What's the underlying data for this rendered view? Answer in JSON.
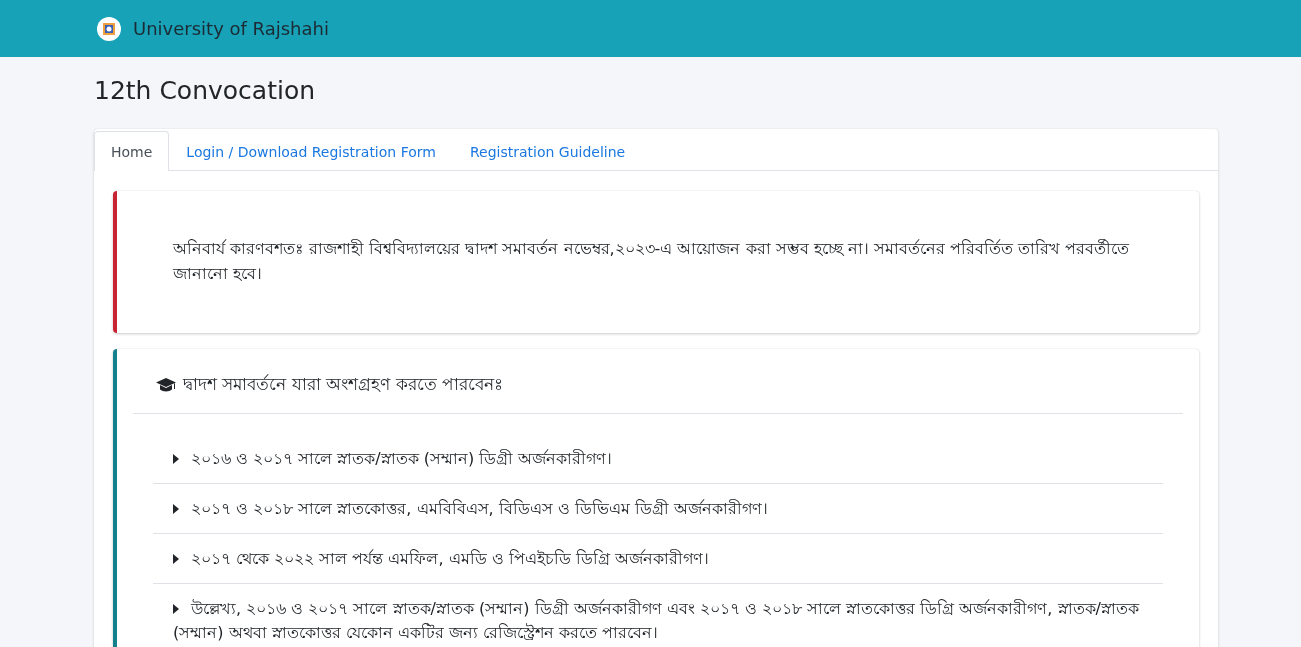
{
  "navbar": {
    "brand": "University of Rajshahi"
  },
  "page_title": "12th Convocation",
  "tabs": [
    {
      "label": "Home",
      "selected": true
    },
    {
      "label": "Login / Download Registration Form",
      "selected": false
    },
    {
      "label": "Registration Guideline",
      "selected": false
    }
  ],
  "notice": {
    "text": "অনিবার্য কারণবশতঃ রাজশাহী বিশ্ববিদ্যালয়ের দ্বাদশ সমাবর্তন নভেম্বর,২০২৩-এ আয়োজন করা সম্ভব হচ্ছে না। সমাবর্তনের পরিবর্তিত তারিখ পরবর্তীতে জানানো হবে।"
  },
  "eligibility": {
    "heading": "দ্বাদশ সমাবর্তনে যারা অংশগ্রহণ করতে পারবেনঃ",
    "items": [
      "২০১৬ ও ২০১৭ সালে স্নাতক/স্নাতক (সম্মান) ডিগ্রী অর্জনকারীগণ।",
      "২০১৭ ও ২০১৮ সালে স্নাতকোত্তর, এমবিবিএস, বিডিএস ও ডিভিএম ডিগ্রী অর্জনকারীগণ।",
      "২০১৭ থেকে ২০২২ সাল পর্যন্ত এমফিল, এমডি ও পিএইচডি ডিগ্রি অর্জনকারীগণ।",
      "উল্লেখ্য, ২০১৬ ও ২০১৭ সালে স্নাতক/স্নাতক (সম্মান) ডিগ্রী অর্জনকারীগণ এবং ২০১৭ ও ২০১৮ সালে স্নাতকোত্তর ডিগ্রি অর্জনকারীগণ, স্নাতক/স্নাতক (সম্মান) অথবা স্নাতকোত্তর যেকোন একটির জন্য রেজিস্ট্রেশন করতে পারবেন।"
    ]
  }
}
